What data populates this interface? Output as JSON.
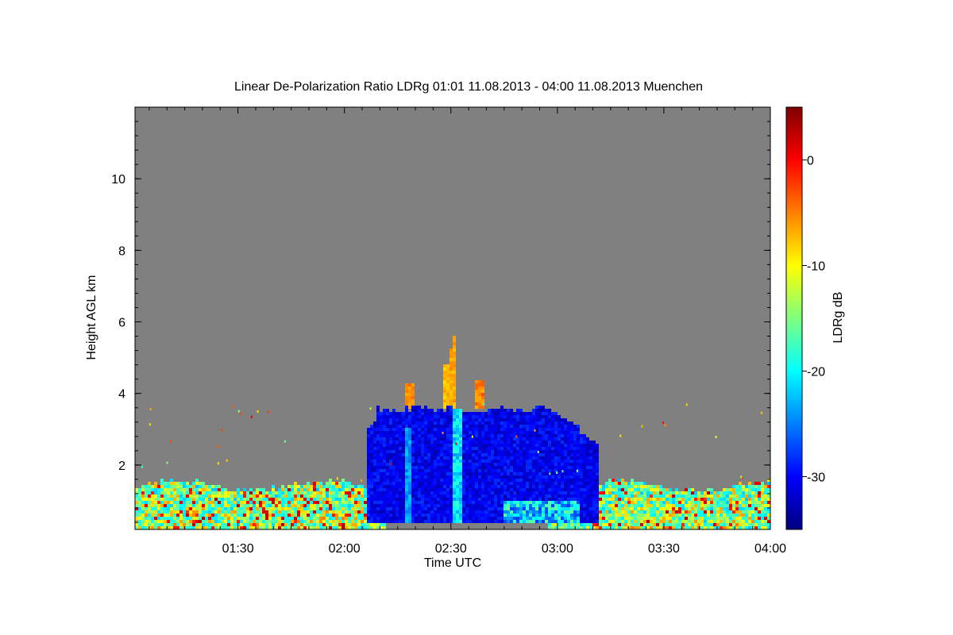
{
  "chart_data": {
    "type": "heatmap",
    "title": "Linear De-Polarization Ratio LDRg   01:01 11.08.2013 - 04:00 11.08.2013 Muenchen",
    "xlabel": "Time UTC",
    "ylabel": "Height AGL km",
    "colorbar_label": "LDRg dB",
    "x_range_hours": [
      1.0167,
      4.0
    ],
    "y_range_km": [
      0.2,
      12.0
    ],
    "x_ticks": [
      {
        "value": 1.5,
        "label": "01:30"
      },
      {
        "value": 2.0,
        "label": "02:00"
      },
      {
        "value": 2.5,
        "label": "02:30"
      },
      {
        "value": 3.0,
        "label": "03:00"
      },
      {
        "value": 3.5,
        "label": "03:30"
      },
      {
        "value": 4.0,
        "label": "04:00"
      }
    ],
    "y_ticks": [
      {
        "value": 2,
        "label": "2"
      },
      {
        "value": 4,
        "label": "4"
      },
      {
        "value": 6,
        "label": "6"
      },
      {
        "value": 8,
        "label": "8"
      },
      {
        "value": 10,
        "label": "10"
      }
    ],
    "colorbar_range_db": [
      -35,
      5
    ],
    "colorbar_ticks": [
      {
        "value": 0,
        "label": "0"
      },
      {
        "value": -10,
        "label": "-10"
      },
      {
        "value": -20,
        "label": "-20"
      },
      {
        "value": -30,
        "label": "-30"
      }
    ],
    "background_color": "#808080",
    "colormap": "jet",
    "regions": [
      {
        "name": "boundary-layer-aerosol",
        "t_start": 1.0167,
        "t_end": 4.0,
        "h_top": 1.6,
        "ldr_db": -10
      },
      {
        "name": "cloud-body",
        "t_start": 2.1,
        "t_end": 3.2,
        "h_bottom": 0.3,
        "h_top": 3.7,
        "ldr_db": -31
      },
      {
        "name": "cloud-top-ice",
        "t_start": 2.25,
        "t_end": 2.65,
        "h_bottom": 3.6,
        "h_top": 5.6,
        "ldr_db": -8
      }
    ]
  }
}
